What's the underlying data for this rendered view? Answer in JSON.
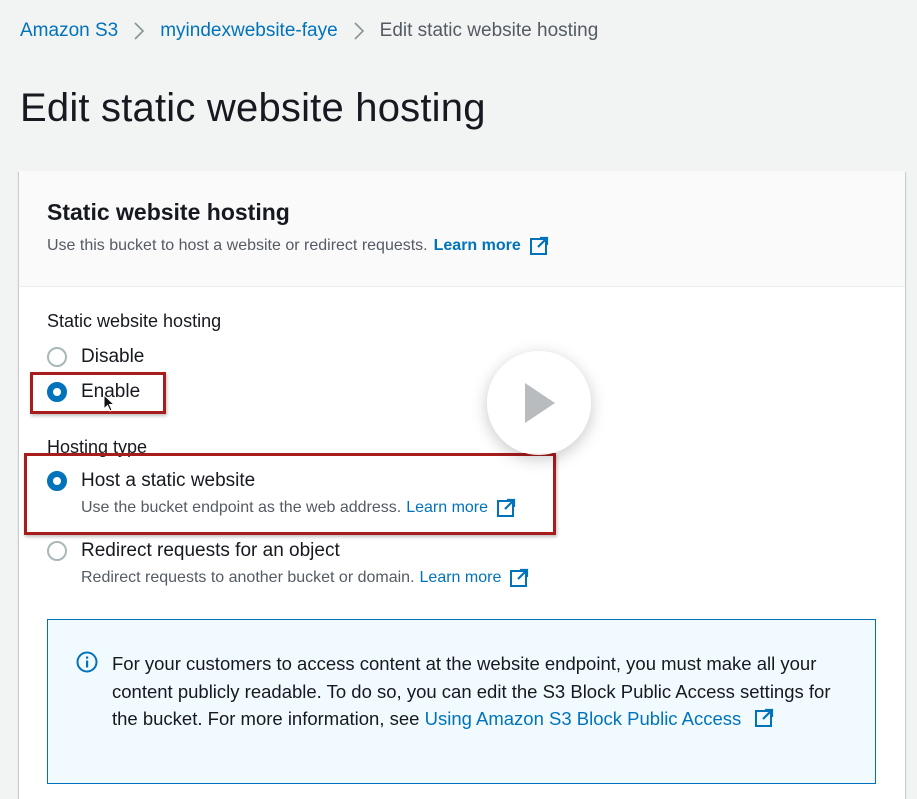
{
  "breadcrumb": {
    "items": [
      "Amazon S3",
      "myindexwebsite-faye"
    ],
    "current": "Edit static website hosting"
  },
  "page": {
    "title": "Edit static website hosting"
  },
  "panel": {
    "title": "Static website hosting",
    "description": "Use this bucket to host a website or redirect requests.",
    "learn_more": "Learn more"
  },
  "hosting": {
    "label": "Static website hosting",
    "options": [
      {
        "label": "Disable",
        "selected": false
      },
      {
        "label": "Enable",
        "selected": true
      }
    ]
  },
  "hosting_type": {
    "label": "Hosting type",
    "options": [
      {
        "label": "Host a static website",
        "description": "Use the bucket endpoint as the web address.",
        "link": "Learn more",
        "selected": true
      },
      {
        "label": "Redirect requests for an object",
        "description": "Redirect requests to another bucket or domain.",
        "link": "Learn more",
        "selected": false
      }
    ]
  },
  "info": {
    "text": "For your customers to access content at the website endpoint, you must make all your content publicly readable. To do so, you can edit the S3 Block Public Access settings for the bucket. For more information, see",
    "link": "Using Amazon S3 Block Public Access"
  },
  "colors": {
    "link": "#0073bb",
    "radio_selected": "#0073bb",
    "highlight": "#a81c1c",
    "info_bg": "#f1faff"
  },
  "icons": [
    "chevron-right-icon",
    "external-link-icon",
    "info-icon",
    "play-icon",
    "mouse-cursor-icon"
  ]
}
